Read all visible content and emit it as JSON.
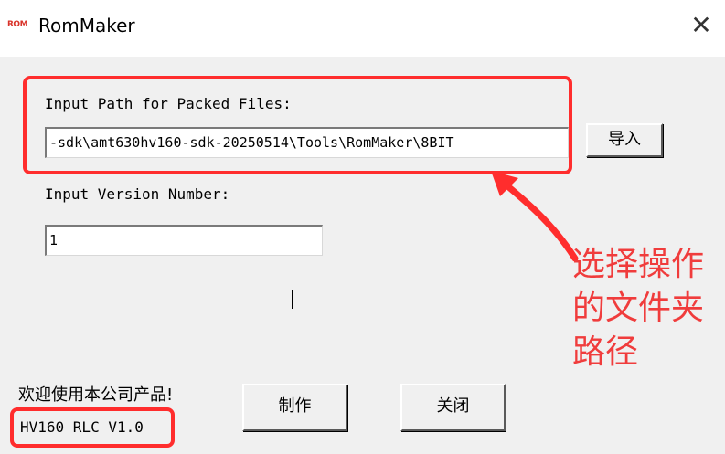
{
  "window": {
    "icon_text": "ROM",
    "title": "RomMaker",
    "close_label": "✕"
  },
  "form": {
    "path_label": "Input Path for Packed Files:",
    "path_value": "-sdk\\amt630hv160-sdk-20250514\\Tools\\RomMaker\\8BIT",
    "import_button": "导入",
    "version_label": "Input Version Number:",
    "version_value": "1"
  },
  "footer": {
    "welcome_text": "欢迎使用本公司产品!",
    "version_text": "HV160 RLC V1.0",
    "make_button": "制作",
    "close_button": "关闭"
  },
  "annotation": {
    "lines": [
      "选择操作",
      "的文件夹",
      "路径"
    ],
    "color": "#f03c3c"
  },
  "colors": {
    "highlight": "#ff2d2d",
    "dialog_bg": "#f0f0f0"
  }
}
